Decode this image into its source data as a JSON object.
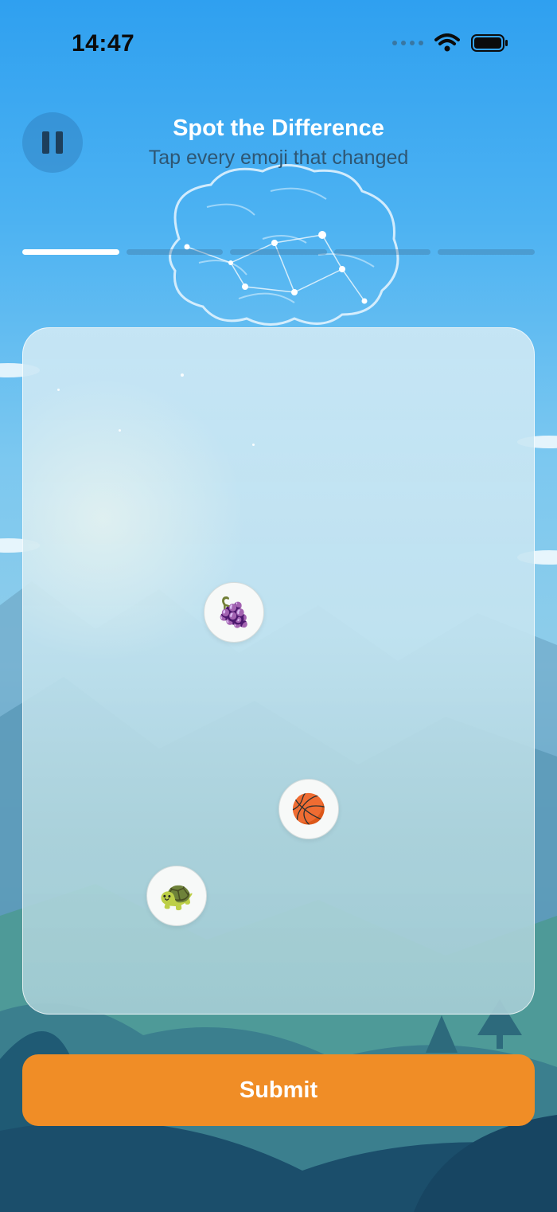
{
  "status_bar": {
    "time": "14:47"
  },
  "header": {
    "title": "Spot the Difference",
    "subtitle": "Tap every emoji that changed"
  },
  "progress": {
    "total_rounds": 5,
    "current_round": 1
  },
  "board": {
    "emojis": [
      {
        "name": "grapes",
        "glyph": "🍇"
      },
      {
        "name": "basketball",
        "glyph": "🏀"
      },
      {
        "name": "turtle",
        "glyph": "🐢"
      }
    ]
  },
  "actions": {
    "submit_label": "Submit"
  },
  "colors": {
    "accent": "#f08d26",
    "sky": "#2fa0f0"
  },
  "icons": {
    "pause": "pause-icon",
    "wifi": "wifi-icon",
    "battery": "battery-icon",
    "brain": "brain-icon"
  }
}
